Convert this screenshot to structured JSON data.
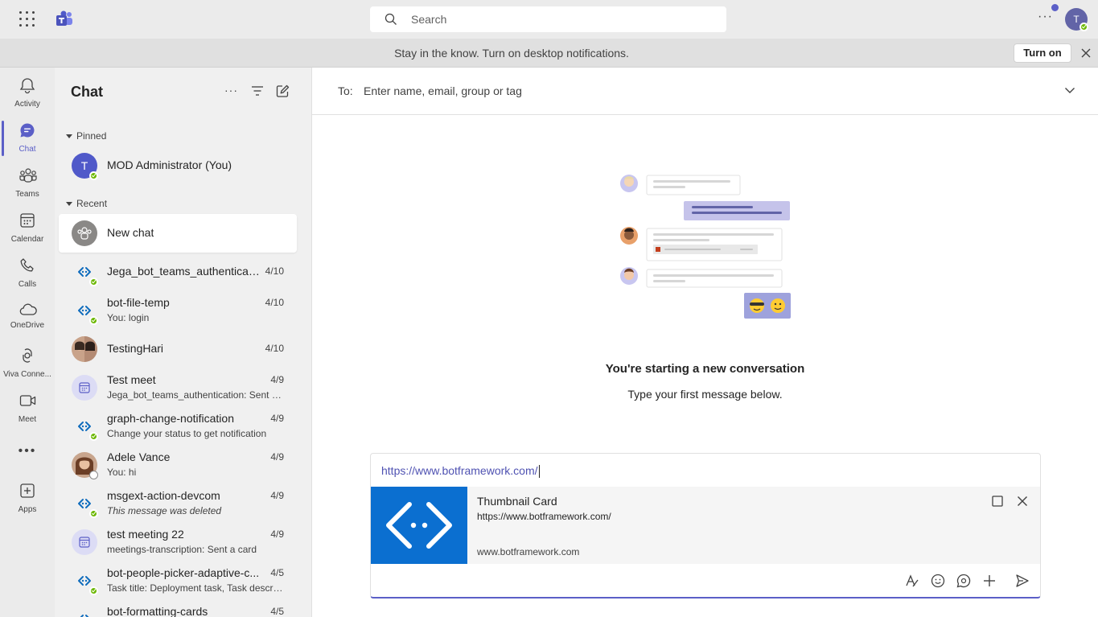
{
  "topbar": {
    "search_placeholder": "Search",
    "user_initial": "T"
  },
  "notification": {
    "message": "Stay in the know. Turn on desktop notifications.",
    "button_label": "Turn on"
  },
  "rail": {
    "items": [
      {
        "label": "Activity",
        "icon": "bell-icon"
      },
      {
        "label": "Chat",
        "icon": "chat-icon"
      },
      {
        "label": "Teams",
        "icon": "teams-icon"
      },
      {
        "label": "Calendar",
        "icon": "calendar-icon"
      },
      {
        "label": "Calls",
        "icon": "phone-icon"
      },
      {
        "label": "OneDrive",
        "icon": "cloud-icon"
      },
      {
        "label": "Viva Conne...",
        "icon": "viva-icon"
      },
      {
        "label": "Meet",
        "icon": "video-icon"
      },
      {
        "label": "Apps",
        "icon": "apps-icon"
      }
    ],
    "more": "•••"
  },
  "chat_list": {
    "title": "Chat",
    "pinned_label": "Pinned",
    "recent_label": "Recent",
    "pinned": [
      {
        "name": "MOD Administrator (You)",
        "initial": "T"
      }
    ],
    "recent": [
      {
        "name": "New chat",
        "sub": "",
        "date": ""
      },
      {
        "name": "Jega_bot_teams_authenticati...",
        "sub": "",
        "date": "4/10"
      },
      {
        "name": "bot-file-temp",
        "sub": "You: login",
        "date": "4/10"
      },
      {
        "name": "TestingHari",
        "sub": "",
        "date": "4/10"
      },
      {
        "name": "Test meet",
        "sub": "Jega_bot_teams_authentication: Sent a ...",
        "date": "4/9"
      },
      {
        "name": "graph-change-notification",
        "sub": "Change your status to get notification",
        "date": "4/9"
      },
      {
        "name": "Adele Vance",
        "sub": "You: hi",
        "date": "4/9"
      },
      {
        "name": "msgext-action-devcom",
        "sub": "This message was deleted",
        "date": "4/9"
      },
      {
        "name": "test meeting 22",
        "sub": "meetings-transcription: Sent a card",
        "date": "4/9"
      },
      {
        "name": "bot-people-picker-adaptive-c...",
        "sub": "Task title: Deployment task, Task descrip...",
        "date": "4/5"
      },
      {
        "name": "bot-formatting-cards",
        "sub": "",
        "date": "4/5"
      }
    ]
  },
  "main": {
    "to_label": "To:",
    "to_placeholder": "Enter name, email, group or tag",
    "start_title": "You're starting a new conversation",
    "start_sub": "Type your first message below."
  },
  "compose": {
    "text": "https://www.botframework.com/",
    "card": {
      "title": "Thumbnail Card",
      "url": "https://www.botframework.com/",
      "domain": "www.botframework.com"
    }
  },
  "colors": {
    "accent": "#5b5fc7",
    "presence_available": "#6bb700",
    "thumbnail_bg": "#0b6fd0"
  }
}
